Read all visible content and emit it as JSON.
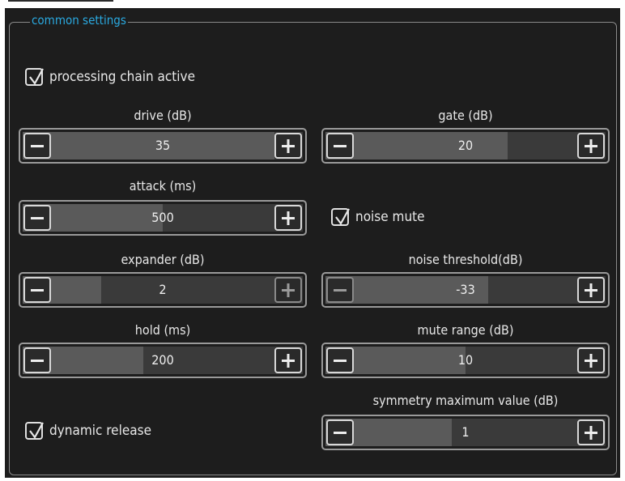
{
  "group": {
    "title": "common settings"
  },
  "checkboxes": {
    "processing_chain_active": {
      "label": "processing chain active",
      "checked": true
    },
    "noise_mute": {
      "label": "noise mute",
      "checked": true
    },
    "dynamic_release": {
      "label": "dynamic release",
      "checked": true
    }
  },
  "sliders": {
    "drive": {
      "label": "drive (dB)",
      "value": "35",
      "fill_fraction": 0.9
    },
    "gate": {
      "label": "gate (dB)",
      "value": "20",
      "fill_fraction": 0.65
    },
    "attack": {
      "label": "attack (ms)",
      "value": "500",
      "fill_fraction": 0.5
    },
    "expander": {
      "label": "expander (dB)",
      "value": "2",
      "fill_fraction": 0.28
    },
    "noise_threshold": {
      "label": "noise threshold(dB)",
      "value": "-33",
      "fill_fraction": 0.58
    },
    "hold": {
      "label": "hold (ms)",
      "value": "200",
      "fill_fraction": 0.43
    },
    "mute_range": {
      "label": "mute range (dB)",
      "value": "10",
      "fill_fraction": 0.5
    },
    "symmetry_max": {
      "label": "symmetry maximum value (dB)",
      "value": "1",
      "fill_fraction": 0.45
    }
  },
  "icons": {
    "minus": "minus-icon",
    "plus": "plus-icon",
    "check": "checkmark-icon"
  },
  "colors": {
    "accent": "#2aa9e0",
    "background": "#1d1d1d",
    "track": "#3a3a3a",
    "fill": "#5a5a5a"
  }
}
